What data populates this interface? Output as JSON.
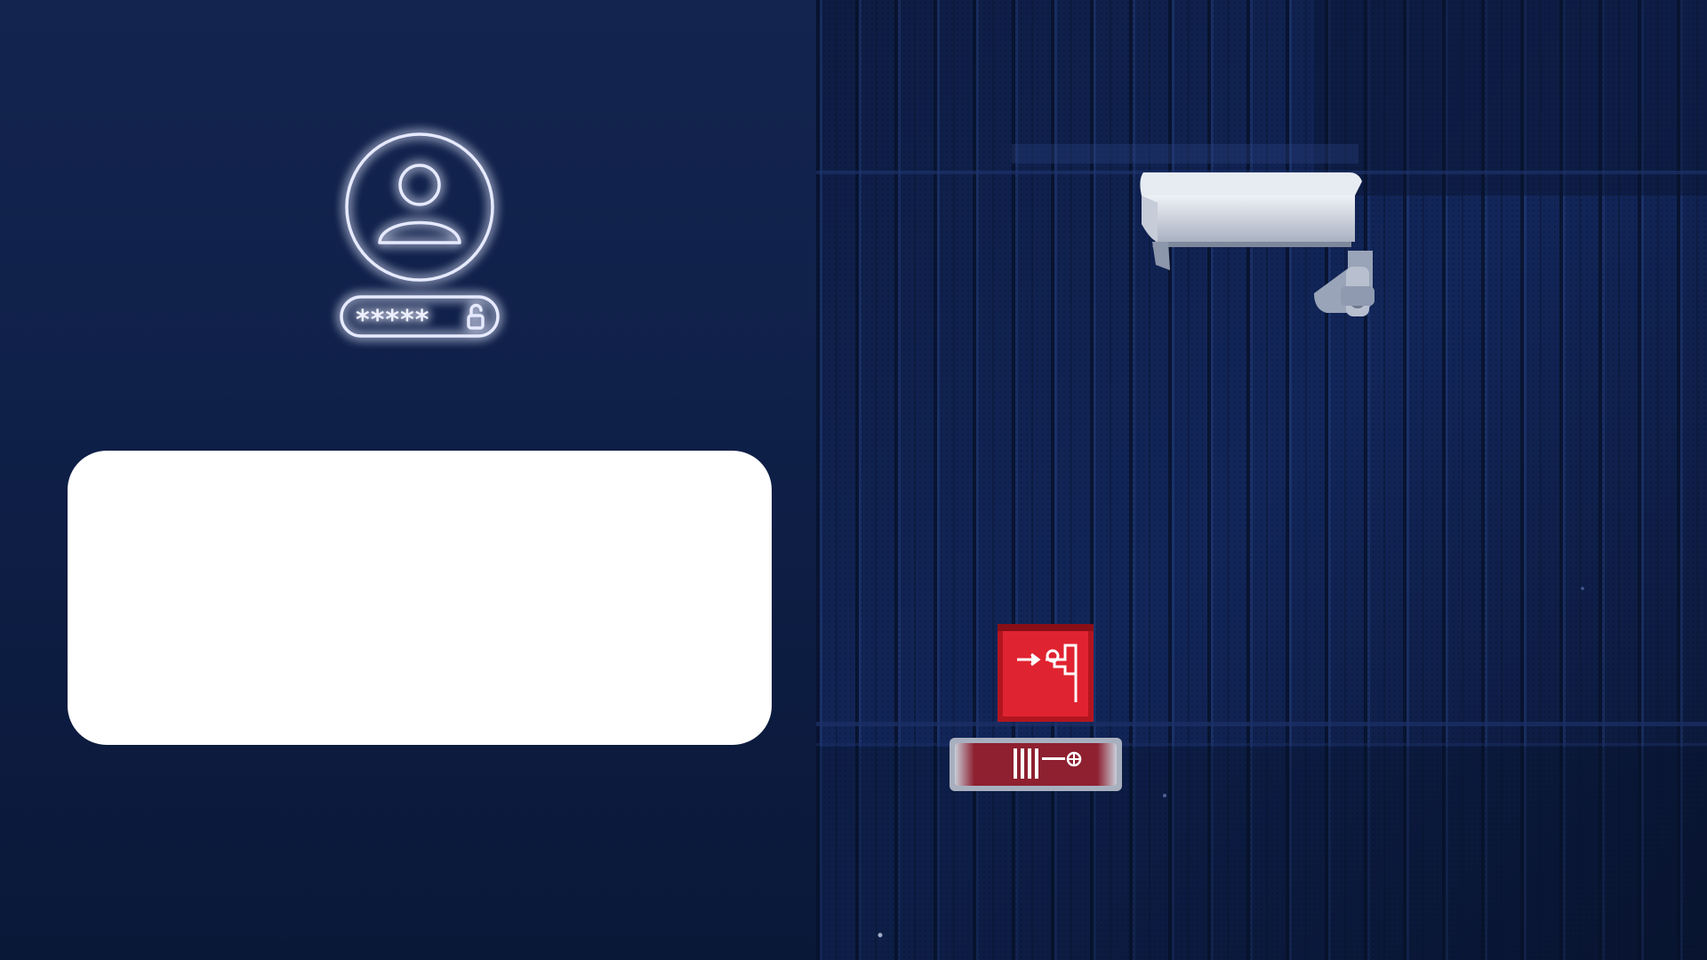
{
  "login_icon": {
    "user_icon": "user-circle-icon",
    "password_mask": "*****",
    "lock_icon": "unlock-icon",
    "glow_color": "#6f86ff"
  },
  "white_card": {},
  "photo": {
    "objects": [
      "security-camera",
      "fire-alarm-box",
      "fire-hose-sign"
    ],
    "colors": {
      "wall": "#0c1a3e",
      "alarm_red": "#d81e2c",
      "camera": "#d9dde6"
    }
  }
}
